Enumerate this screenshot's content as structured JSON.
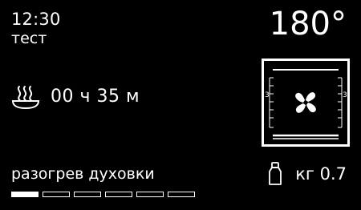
{
  "display": {
    "time": "12:30",
    "program_name": "тест",
    "temperature": "180°",
    "timer": "00 ч 35 м",
    "status": "разогрев духовки",
    "weight": "кг 0.7",
    "oven_level_left": "3",
    "oven_level_right": "3"
  },
  "progress": {
    "segments_total": 6,
    "segments_filled": 1
  },
  "icons": {
    "timer": "steam-dish-icon",
    "oven": "convection-fan-icon",
    "weight": "weight-icon"
  },
  "colors": {
    "background": "#000000",
    "foreground": "#ffffff"
  }
}
